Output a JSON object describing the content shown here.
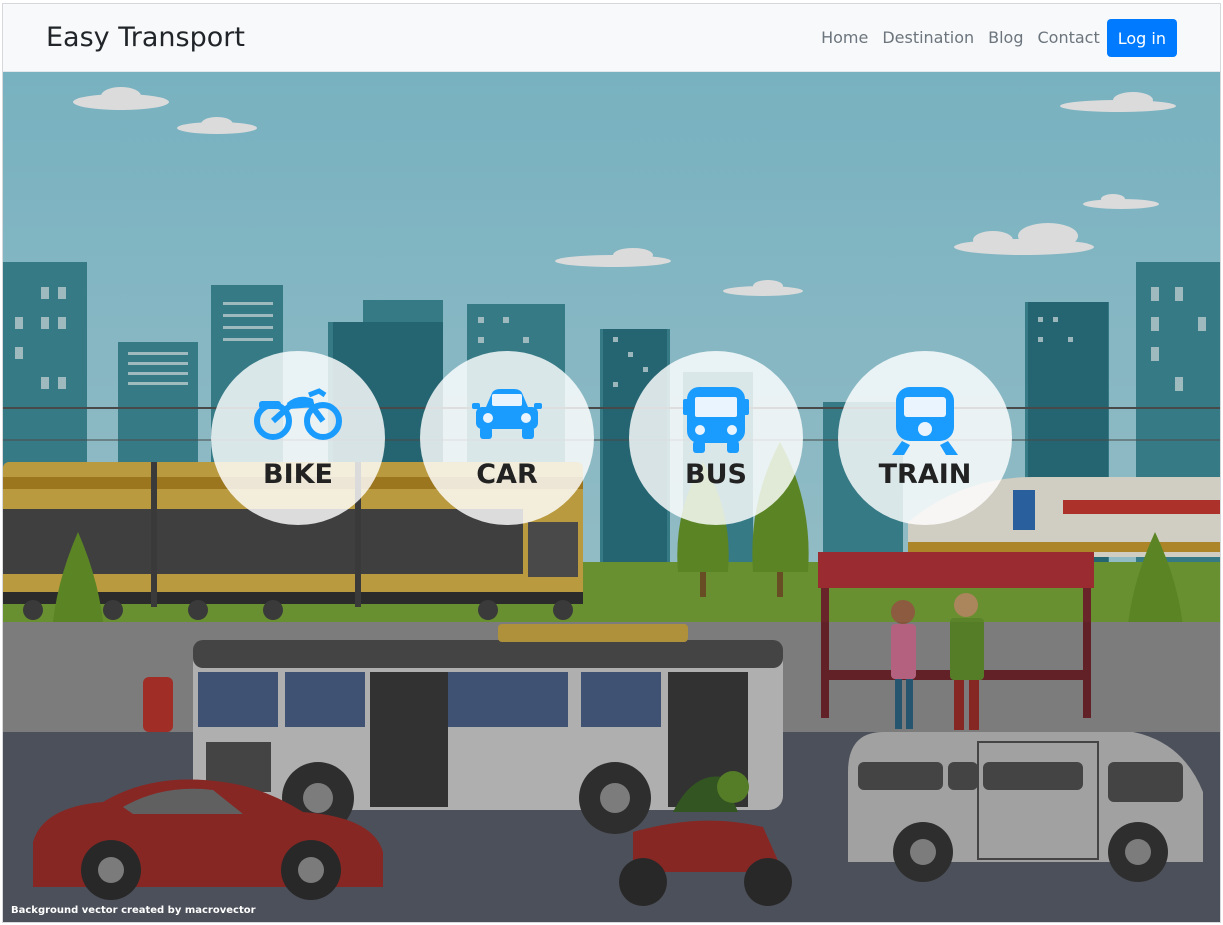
{
  "navbar": {
    "brand": "Easy Transport",
    "links": [
      "Home",
      "Destination",
      "Blog",
      "Contact"
    ],
    "login": "Log in"
  },
  "hero": {
    "options": [
      {
        "label": "BIKE",
        "icon": "motorcycle-icon"
      },
      {
        "label": "CAR",
        "icon": "car-icon"
      },
      {
        "label": "BUS",
        "icon": "bus-icon"
      },
      {
        "label": "TRAIN",
        "icon": "train-icon"
      }
    ],
    "credit": "Background vector created by macrovector"
  },
  "colors": {
    "accent": "#007bff",
    "icon_blue": "#1a9cff",
    "sky": "#8ecfe0"
  }
}
